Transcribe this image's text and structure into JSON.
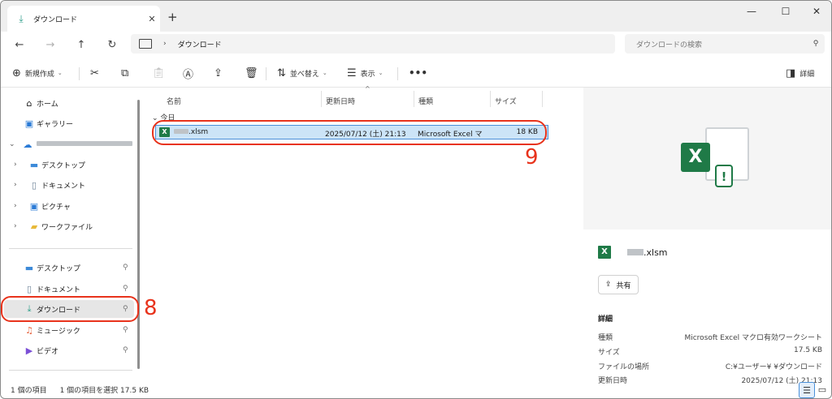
{
  "tab": {
    "icon": "download-icon",
    "title": "ダウンロード"
  },
  "address": {
    "location": "ダウンロード"
  },
  "search": {
    "placeholder": "ダウンロードの検索"
  },
  "toolbar": {
    "new": "新規作成",
    "sort": "並べ替え",
    "view": "表示",
    "details": "詳細"
  },
  "sidebar": {
    "home": "ホーム",
    "gallery": "ギャラリー",
    "desktop": "デスクトップ",
    "documents": "ドキュメント",
    "pictures": "ピクチャ",
    "work_files": "ワークファイル",
    "pinned": {
      "desktop": "デスクトップ",
      "documents": "ドキュメント",
      "downloads": "ダウンロード",
      "music": "ミュージック",
      "videos": "ビデオ"
    }
  },
  "columns": {
    "name": "名前",
    "modified": "更新日時",
    "type": "種類",
    "size": "サイズ"
  },
  "group": "今日",
  "file": {
    "name": ".xlsm",
    "modified": "2025/07/12 (土) 21:13",
    "type": "Microsoft Excel マ",
    "size": "18 KB"
  },
  "annotations": {
    "a8": "8",
    "a9": "9"
  },
  "preview": {
    "name": ".xlsm",
    "share": "共有",
    "details_heading": "詳細",
    "rows": [
      {
        "k": "種類",
        "v": "Microsoft Excel マクロ有効ワークシート"
      },
      {
        "k": "サイズ",
        "v": "17.5 KB"
      },
      {
        "k": "ファイルの場所",
        "v": "C:¥ユーザー¥          ¥ダウンロード"
      },
      {
        "k": "更新日時",
        "v": "2025/07/12 (土) 21:13"
      }
    ]
  },
  "status": {
    "count": "1 個の項目",
    "selected": "1 個の項目を選択  17.5 KB"
  },
  "colors": {
    "accent_red": "#e8331c",
    "selection": "#cce4f7",
    "excel_green": "#1f7a47"
  }
}
